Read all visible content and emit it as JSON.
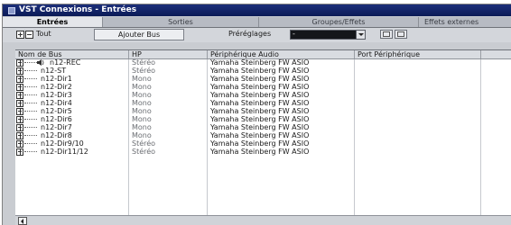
{
  "window": {
    "title": "VST Connexions - Entrées"
  },
  "tabs": [
    {
      "label": "Entrées",
      "active": true
    },
    {
      "label": "Sorties",
      "active": false
    },
    {
      "label": "Groupes/Effets",
      "active": false
    },
    {
      "label": "Effets externes",
      "active": false
    }
  ],
  "toolbar": {
    "tout_label": "Tout",
    "add_bus_label": "Ajouter Bus",
    "presets_label": "Préréglages",
    "presets_value": "-"
  },
  "table": {
    "columns": [
      "Nom de Bus",
      "HP",
      "Périphérique Audio",
      "Port Périphérique"
    ],
    "rows": [
      {
        "name": "n12-REC",
        "hp": "Stéréo",
        "device": "Yamaha Steinberg FW ASIO",
        "port": "",
        "has_speaker_icon": true
      },
      {
        "name": "n12-ST",
        "hp": "Stéréo",
        "device": "Yamaha Steinberg FW ASIO",
        "port": ""
      },
      {
        "name": "n12-Dir1",
        "hp": "Mono",
        "device": "Yamaha Steinberg FW ASIO",
        "port": ""
      },
      {
        "name": "n12-Dir2",
        "hp": "Mono",
        "device": "Yamaha Steinberg FW ASIO",
        "port": ""
      },
      {
        "name": "n12-Dir3",
        "hp": "Mono",
        "device": "Yamaha Steinberg FW ASIO",
        "port": ""
      },
      {
        "name": "n12-Dir4",
        "hp": "Mono",
        "device": "Yamaha Steinberg FW ASIO",
        "port": ""
      },
      {
        "name": "n12-Dir5",
        "hp": "Mono",
        "device": "Yamaha Steinberg FW ASIO",
        "port": ""
      },
      {
        "name": "n12-Dir6",
        "hp": "Mono",
        "device": "Yamaha Steinberg FW ASIO",
        "port": ""
      },
      {
        "name": "n12-Dir7",
        "hp": "Mono",
        "device": "Yamaha Steinberg FW ASIO",
        "port": ""
      },
      {
        "name": "n12-Dir8",
        "hp": "Mono",
        "device": "Yamaha Steinberg FW ASIO",
        "port": ""
      },
      {
        "name": "n12-Dir9/10",
        "hp": "Stéréo",
        "device": "Yamaha Steinberg FW ASIO",
        "port": ""
      },
      {
        "name": "n12-Dir11/12",
        "hp": "Stéréo",
        "device": "Yamaha Steinberg FW ASIO",
        "port": ""
      }
    ]
  },
  "colors": {
    "titlebar": "#0b1a56",
    "panel": "#c9ccd1",
    "header": "#d9dce1"
  }
}
